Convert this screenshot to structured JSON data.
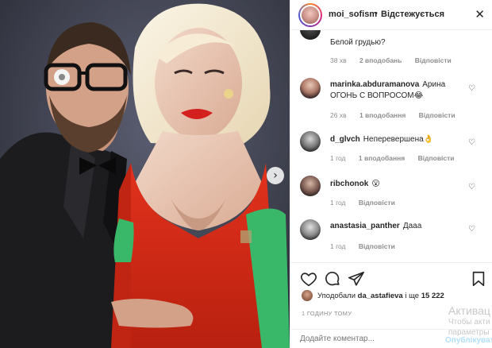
{
  "post": {
    "username": "moi_sofism",
    "separator": "•",
    "follow_label": "Відстежується",
    "close_glyph": "✕"
  },
  "comments": [
    {
      "username": "",
      "text": "Белой грудью?",
      "time": "38 хв",
      "likes": "2 вподобань",
      "reply": "Відповісти",
      "avatar_icon": "avatar-dark-partial"
    },
    {
      "username": "marinka.abduramanova",
      "text": "Арина ОГОНЬ С ВОПРОСОМ😂",
      "time": "26 хв",
      "likes": "1 вподобання",
      "reply": "Відповісти",
      "avatar_icon": "avatar-woman"
    },
    {
      "username": "d_glvch",
      "text": "Неперевершена👌",
      "time": "1 год",
      "likes": "1 вподобання",
      "reply": "Відповісти",
      "avatar_icon": "avatar-man-bw"
    },
    {
      "username": "ribchonok",
      "text": "😮",
      "time": "1 год",
      "likes": "",
      "reply": "Відповісти",
      "avatar_icon": "avatar-woman-dark"
    },
    {
      "username": "anastasia_panther",
      "text": "Дааа",
      "time": "1 год",
      "likes": "",
      "reply": "Відповісти",
      "avatar_icon": "avatar-woman-bw"
    }
  ],
  "actions": {
    "like_icon": "heart-outline-icon",
    "comment_icon": "comment-bubble-icon",
    "share_icon": "paper-plane-icon",
    "save_icon": "bookmark-icon"
  },
  "likes": {
    "prefix": "Уподобали",
    "user": "da_astafieva",
    "middle": "і ще",
    "count": "15 222"
  },
  "timestamp": "1 ГОДИНУ ТОМУ",
  "comment_box": {
    "placeholder": "Додайте коментар...",
    "publish_label": "Опублікувати"
  },
  "watermark": {
    "title": "Активац",
    "line1": "Чтобы акти",
    "line2": "параметры"
  },
  "colors": {
    "accent_link": "#b2dffc",
    "muted": "#8e8e8e",
    "text": "#262626"
  }
}
